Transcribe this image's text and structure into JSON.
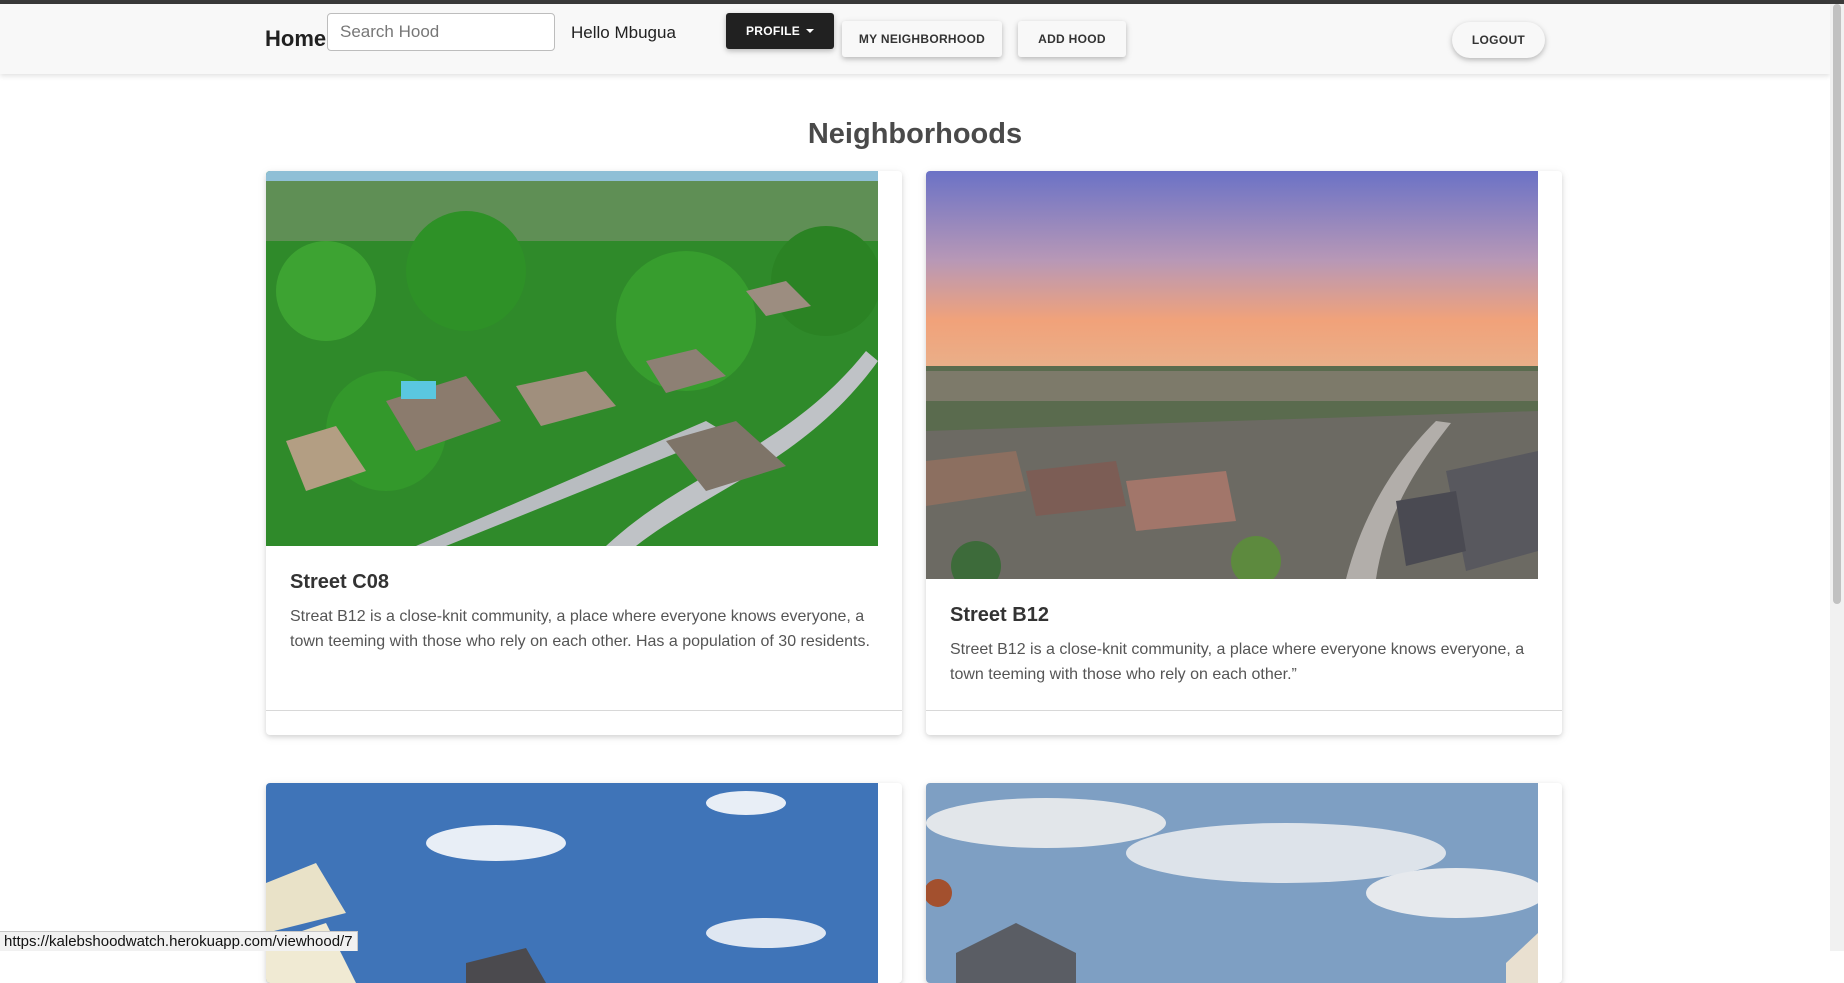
{
  "navbar": {
    "brand": "Home",
    "search_placeholder": "Search Hood",
    "greeting": "Hello Mbugua",
    "profile_label": "PROFILE",
    "my_neighborhood_label": "MY NEIGHBORHOOD",
    "add_hood_label": "ADD HOOD",
    "logout_label": "LOGOUT"
  },
  "page": {
    "title": "Neighborhoods"
  },
  "cards": [
    {
      "title": "Street C08",
      "text": "Streat B12 is a close-knit community, a place where everyone knows everyone, a town teeming with those who rely on each other. Has a population of 30 residents."
    },
    {
      "title": "Street B12",
      "text": "Street B12 is a close-knit community, a place where everyone knows everyone, a town teeming with those who rely on each other.”"
    }
  ],
  "status_bar": {
    "url": "https://kalebshoodwatch.herokuapp.com/viewhood/7"
  },
  "colors": {
    "navbar_bg": "#f8f8f8",
    "profile_btn_bg": "#212121",
    "page_bg": "#ffffff"
  }
}
